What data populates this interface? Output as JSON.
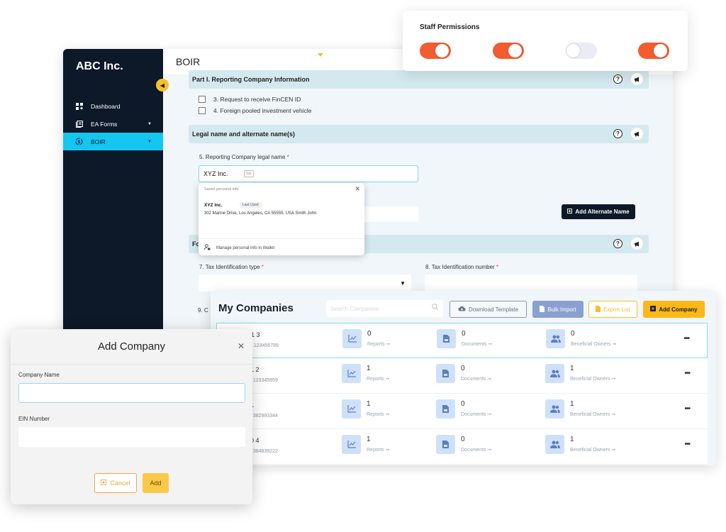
{
  "app": {
    "brand": "ABC Inc.",
    "page_title": "BOIR",
    "sidebar": {
      "items": [
        {
          "label": "Dashboard",
          "icon": "dashboard-grid-icon",
          "has_caret": false,
          "active": false
        },
        {
          "label": "EA Forms",
          "icon": "forms-icon",
          "has_caret": true,
          "active": false
        },
        {
          "label": "BOIR",
          "icon": "dollar-cycle-icon",
          "has_caret": true,
          "active": true
        }
      ]
    },
    "form": {
      "section_part1": "Part I. Reporting Company Information",
      "checkboxes": [
        {
          "label": "3. Request to receive FinCEN ID",
          "checked": false
        },
        {
          "label": "4. Foreign pooled investment vehicle",
          "checked": false
        }
      ],
      "section_legal": "Legal name and alternate name(s)",
      "legal_name_label": "5. Reporting Company legal name",
      "legal_name_value": "XYZ Inc.",
      "tab_hint": "Tab",
      "add_alternate_label": "Add Alternate Name",
      "section_form_partial": "Fo",
      "tax_type_label": "7. Tax Identification type",
      "tax_number_label": "8. Tax Identification number",
      "field9_partial": "9. C",
      "required_mark": "*"
    },
    "autofill": {
      "header": "Saved personal info",
      "name": "XYZ Inc.",
      "badge": "Last Used",
      "address": "302 Marine Drive, Los Angeles, CA 55555, USA   Smith   John",
      "manage": "Manage personal info in Wallet"
    }
  },
  "permissions": {
    "title": "Staff Permissions",
    "toggles": [
      true,
      true,
      false,
      true
    ],
    "on_color": "#f25c2f"
  },
  "companies": {
    "title": "My Companies",
    "search_placeholder": "Search Companies",
    "buttons": {
      "download": "Download Template",
      "bulk": "Bulk Import",
      "export": "Export List",
      "add": "Add Company"
    },
    "rows": [
      {
        "name": "1 3",
        "ein": ": 123456789",
        "reports": "0",
        "documents": "0",
        "owners": "0",
        "selected": true
      },
      {
        "name": "1 2",
        "ein": ": 123345859",
        "reports": "1",
        "documents": "0",
        "owners": "1",
        "selected": false
      },
      {
        "name": "1",
        "ein": ": 382993344",
        "reports": "1",
        "documents": "0",
        "owners": "1",
        "selected": false
      },
      {
        "name": "0 4",
        "ein": ": 384839222",
        "reports": "1",
        "documents": "0",
        "owners": "1",
        "selected": false
      }
    ],
    "labels": {
      "reports": "Reports ➞",
      "documents": "Documents ➞",
      "owners": "Beneficial Owners ➞"
    }
  },
  "modal": {
    "title": "Add Company",
    "company_name_label": "Company Name",
    "company_name_value": "",
    "ein_label": "EIN Number",
    "ein_value": "",
    "cancel": "Cancel",
    "add": "Add"
  }
}
